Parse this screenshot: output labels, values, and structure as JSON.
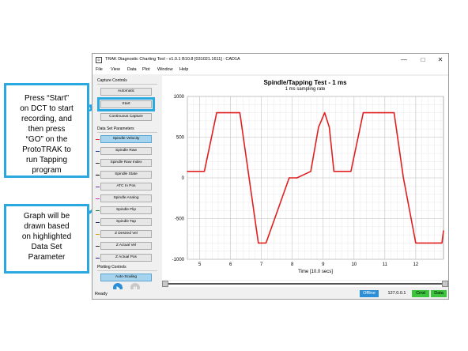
{
  "callouts": {
    "start_instructions": [
      "Press “Start”",
      "on DCT to start",
      "recording, and",
      "then press",
      "“GO” on the",
      "ProtoTRAK to",
      "run Tapping",
      "program"
    ],
    "graph_note": [
      "Graph will be",
      "drawn based",
      "on highlighted",
      "Data Set",
      "Parameter"
    ]
  },
  "window": {
    "title": "TRAK Diagnostic Charting Tool - v1.0.1 B10.8 [031021.1611] : CAD1A",
    "icon_text": "D",
    "minimize_glyph": "—",
    "maximize_glyph": "□",
    "close_glyph": "✕"
  },
  "menu": [
    "File",
    "View",
    "Data",
    "Plot",
    "Window",
    "Help"
  ],
  "capture_controls": {
    "label": "Capture Controls",
    "buttons": [
      "Automatic",
      "Start",
      "Continuous Capture"
    ]
  },
  "data_set_parameters": {
    "label": "Data Set Parameters",
    "items": [
      {
        "label": "Spindle Velocity",
        "color": "#e03030",
        "selected": true
      },
      {
        "label": "Spindle Raw",
        "color": "#1a3fa0",
        "selected": false
      },
      {
        "label": "Spindle Raw Index",
        "color": "#2b2b2b",
        "selected": false
      },
      {
        "label": "Spindle State",
        "color": "#000000",
        "selected": false
      },
      {
        "label": "ATC In Pos",
        "color": "#6a2fa0",
        "selected": false
      },
      {
        "label": "Spindle Analog",
        "color": "#d42bbf",
        "selected": false
      },
      {
        "label": "Spindle Flip",
        "color": "#1a7a2a",
        "selected": false
      },
      {
        "label": "Spindle Tap",
        "color": "#1a2a7a",
        "selected": false
      },
      {
        "label": "Z Desired Vel",
        "color": "#d9a020",
        "selected": false
      },
      {
        "label": "Z Actual Vel",
        "color": "#2b2b2b",
        "selected": false
      },
      {
        "label": "Z Actual Pos",
        "color": "#202080",
        "selected": false
      }
    ]
  },
  "plotting_controls": {
    "label": "Plotting Controls",
    "auto_scaling": "Auto-Scaling",
    "play_icon_color": "#2a8fd6",
    "pause_icon_color": "#c8c8c8"
  },
  "chart_data": {
    "type": "line",
    "title": "Spindle/Tapping Test - 1 ms",
    "subtitle": "1 ms sampling rate",
    "xlabel": "Time [10.0 secs]",
    "ylabel": "",
    "xlim": [
      4.6,
      12.9
    ],
    "ylim": [
      -1000,
      1000
    ],
    "x_ticks": [
      5,
      6,
      7,
      8,
      9,
      10,
      11,
      12
    ],
    "y_ticks": [
      1000,
      500,
      0,
      -500,
      -1000
    ],
    "grid": true,
    "series": [
      {
        "color": "#e02020",
        "x": [
          4.6,
          5.0,
          5.15,
          5.55,
          6.3,
          6.9,
          7.15,
          7.9,
          8.15,
          8.6,
          8.85,
          9.05,
          9.2,
          9.35,
          9.65,
          9.9,
          10.3,
          10.8,
          11.3,
          11.6,
          12.0,
          12.25,
          12.85,
          12.9
        ],
        "y": [
          80,
          80,
          80,
          800,
          800,
          -800,
          -800,
          0,
          0,
          80,
          620,
          800,
          620,
          80,
          80,
          80,
          800,
          800,
          800,
          0,
          -800,
          -800,
          -800,
          -650
        ]
      }
    ]
  },
  "status": {
    "ready": "Ready",
    "offline": "Offline",
    "ip": "127.0.0.1",
    "cmd": "Cmd",
    "data": "Data",
    "offline_color": "#2a8fd6",
    "cmd_color": "#3cc43c",
    "data_color": "#3cc43c"
  }
}
